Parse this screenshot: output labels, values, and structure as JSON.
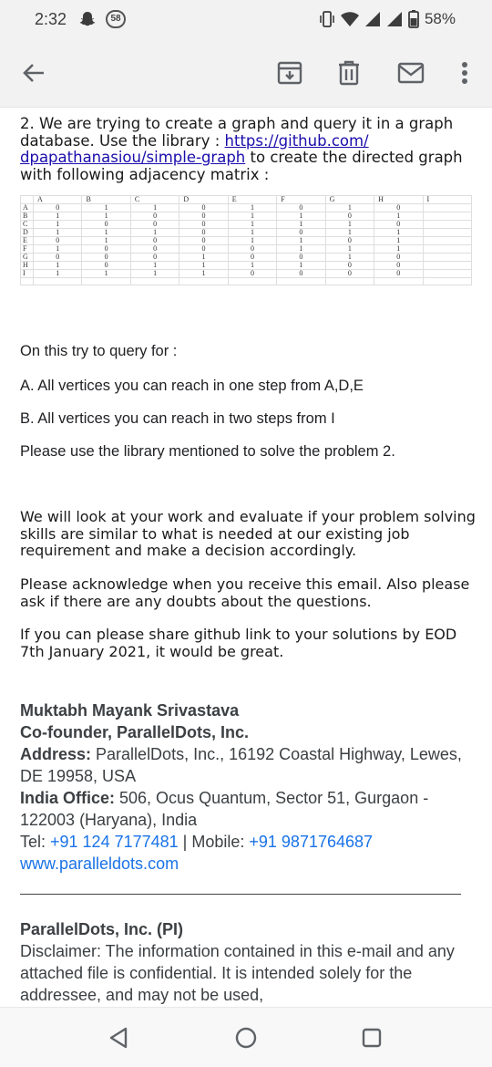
{
  "status_bar": {
    "time": "2:32",
    "notification_count": "58",
    "battery": "58%"
  },
  "email": {
    "question_intro_1": "2. We are trying to create a graph and query it in a graph database. Use the library : ",
    "link_text": "https://github.com/dpapathanasiou/simple-graph",
    "link_text_1": "https://github.com/",
    "link_text_2": "dpapathanasiou/simple-graph",
    "question_intro_2": " to create the directed graph with following adjacency matrix :",
    "matrix": {
      "columns": [
        "A",
        "B",
        "C",
        "D",
        "E",
        "F",
        "G",
        "H",
        "I"
      ],
      "rows": [
        {
          "label": "A",
          "values": [
            "0",
            "1",
            "1",
            "0",
            "1",
            "0",
            "1",
            "0"
          ]
        },
        {
          "label": "B",
          "values": [
            "1",
            "1",
            "0",
            "0",
            "1",
            "1",
            "0",
            "1"
          ]
        },
        {
          "label": "C",
          "values": [
            "1",
            "0",
            "0",
            "0",
            "1",
            "1",
            "1",
            "0"
          ]
        },
        {
          "label": "D",
          "values": [
            "1",
            "1",
            "1",
            "0",
            "1",
            "0",
            "1",
            "1"
          ]
        },
        {
          "label": "E",
          "values": [
            "0",
            "1",
            "0",
            "0",
            "1",
            "1",
            "0",
            "1"
          ]
        },
        {
          "label": "F",
          "values": [
            "1",
            "0",
            "0",
            "0",
            "0",
            "1",
            "1",
            "1"
          ]
        },
        {
          "label": "G",
          "values": [
            "0",
            "0",
            "0",
            "1",
            "0",
            "0",
            "1",
            "0"
          ]
        },
        {
          "label": "H",
          "values": [
            "1",
            "0",
            "1",
            "1",
            "1",
            "1",
            "0",
            "0"
          ]
        },
        {
          "label": "I",
          "values": [
            "1",
            "1",
            "1",
            "1",
            "0",
            "0",
            "0",
            "0"
          ]
        }
      ]
    },
    "try_query": "On this try to query for :",
    "task_a": "A. All vertices you can reach in one step from A,D,E",
    "task_b": "B. All vertices you can reach in two steps from I",
    "use_library": "Please use the library mentioned to solve the problem 2.",
    "evaluate": "We will look at your work and evaluate if your problem solving skills are similar to what is needed at our existing job requirement and make a decision accordingly.",
    "acknowledge": "Please acknowledge when you receive this email. Also please ask if there are any doubts about the questions.",
    "share": "If you can please share github link to your solutions by EOD 7th January 2021, it would be great."
  },
  "signature": {
    "name": "Muktabh Mayank Srivastava",
    "title": "Co-founder, ParallelDots, Inc.",
    "address_label": "Address:",
    "address": " ParallelDots, Inc., 16192 Coastal Highway, Lewes, DE 19958, USA",
    "india_office_label": "India Office:",
    "india_office": " 506, Ocus Quantum, Sector 51, Gurgaon - 122003 (Haryana), India",
    "tel_label": "Tel: ",
    "tel": "+91 124 7177481",
    "mobile_label": " | Mobile: ",
    "mobile": "+91 9871764687",
    "website": "www.paralleldots.com"
  },
  "disclaimer": {
    "company": "ParallelDots, Inc. (PI)",
    "text": "Disclaimer: The information contained in this e-mail and any attached file is confidential. It is intended solely for the addressee, and may not be used,"
  },
  "icons": [
    "back-arrow-icon",
    "archive-icon",
    "delete-icon",
    "mail-icon",
    "more-vert-icon",
    "nav-back-icon",
    "nav-home-icon",
    "nav-recents-icon"
  ],
  "colors": {
    "link": "#1a73e8",
    "bars": "#f2f2f2",
    "icon": "#5f6368"
  }
}
